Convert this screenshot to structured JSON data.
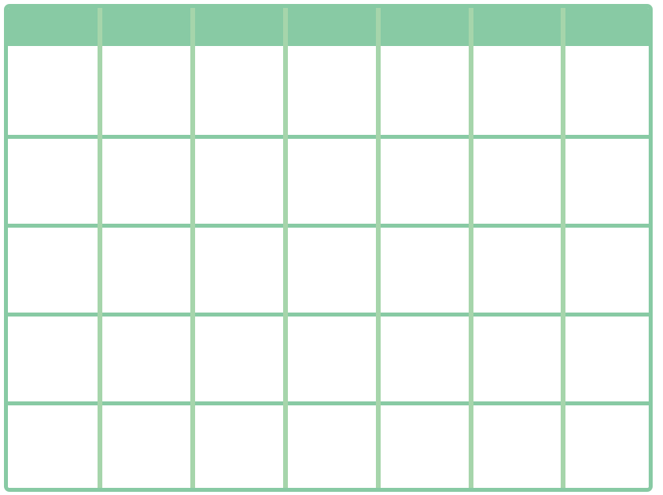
{
  "calendar_grid": {
    "columns": 7,
    "body_rows": 5,
    "colors": {
      "frame": "#88caa4",
      "header": "#88caa4",
      "row_divider": "#88caa4",
      "column_divider": "#a6d5ab",
      "cell_fill": "#ffffff"
    }
  }
}
